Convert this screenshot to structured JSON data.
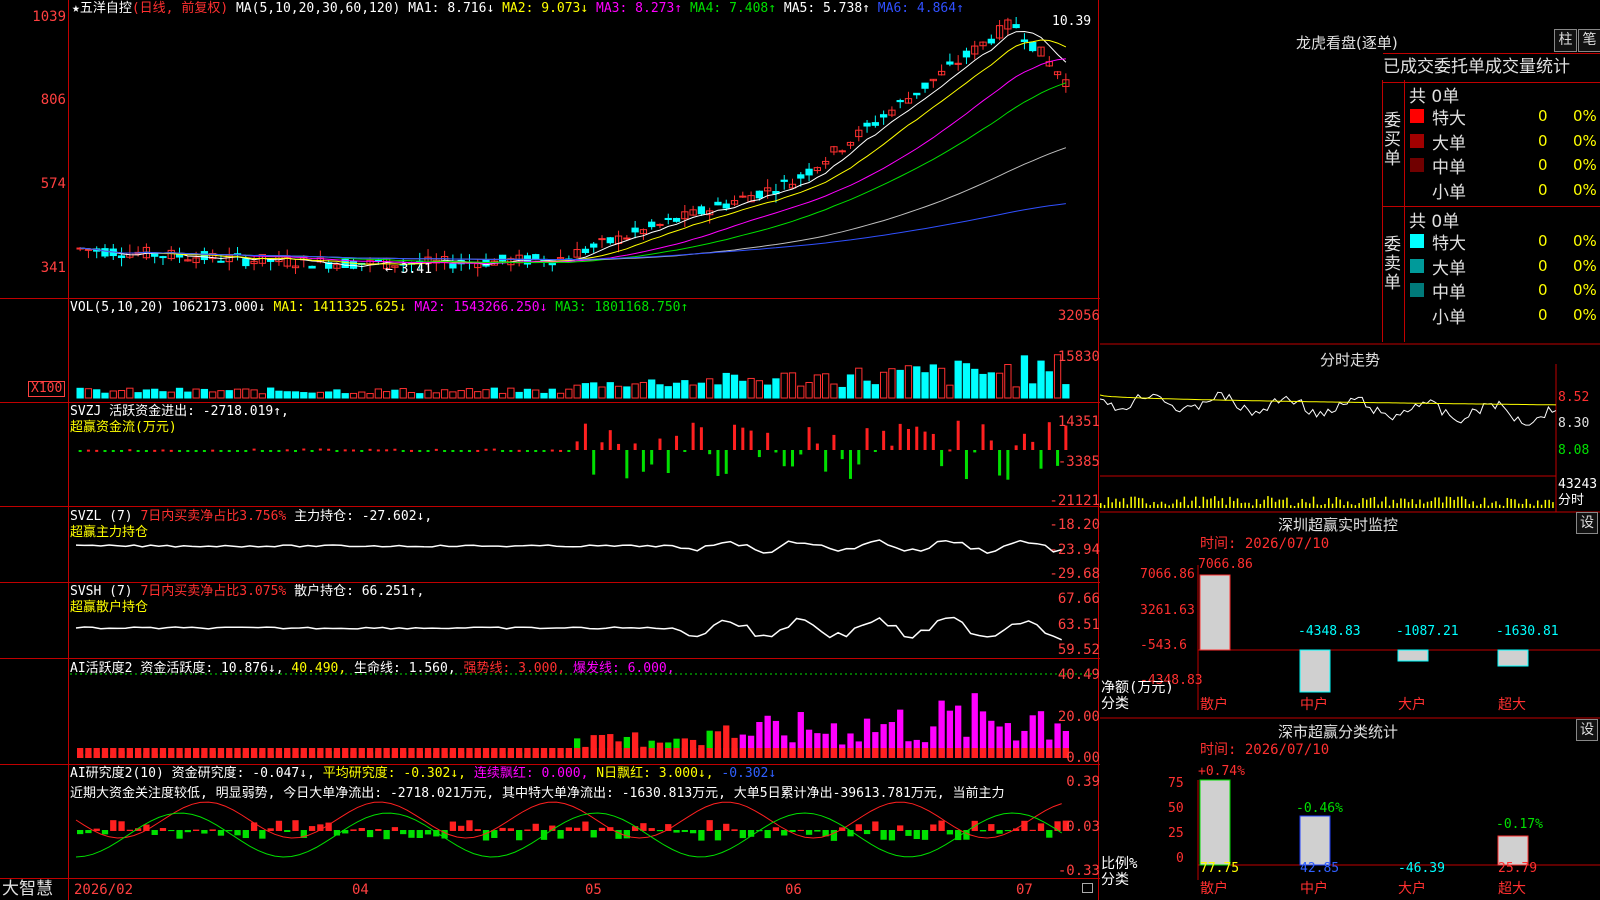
{
  "kline": {
    "title": "五洋自控",
    "period": "(日线, 前复权)",
    "ma_params": "MA(5,10,20,30,60,120)",
    "ma1": "MA1: 8.716↓",
    "ma2": "MA2: 9.073↓",
    "ma3": "MA3: 8.273↑",
    "ma4": "MA4: 7.408↑",
    "ma5": "MA5: 5.738↑",
    "ma6": "MA6: 4.864↑",
    "high_mark": "10.39",
    "low_mark": "← 3.41",
    "y_ticks": [
      "1039",
      "806",
      "574",
      "341"
    ]
  },
  "vol": {
    "label": "VOL(5,10,20)",
    "value": "1062173.000↓",
    "ma1": "MA1: 1411325.625↓",
    "ma2": "MA2: 1543266.250↓",
    "ma3": "MA3: 1801168.750↑",
    "y_ticks": [
      "32056",
      "15830"
    ],
    "unit": "X100"
  },
  "svzj": {
    "label": "SVZJ",
    "desc": "活跃资金进出: -2718.019↑,",
    "sub": "超赢资金流(万元)",
    "y_ticks": [
      "14351",
      "-3385",
      "-21121"
    ]
  },
  "svzl": {
    "label": "SVZL (7)",
    "pct": "7日内买卖净占比3.756%",
    "hold": "主力持仓: -27.602↓,",
    "sub": "超赢主力持仓",
    "y_ticks": [
      "-18.20",
      "-23.94",
      "-29.68"
    ]
  },
  "svsh": {
    "label": "SVSH (7)",
    "pct": "7日内买卖净占比3.075%",
    "hold": "散户持仓: 66.251↑,",
    "sub": "超赢散户持仓",
    "y_ticks": [
      "67.66",
      "63.51",
      "59.52"
    ]
  },
  "ai1": {
    "label": "AI活跃度2",
    "v1": "资金活跃度: 10.876↓,",
    "v2": "40.490,",
    "v3": "生命线: 1.560,",
    "v4": "强势线: 3.000,",
    "v5": "爆发线: 6.000,",
    "y_ticks": [
      "40.49",
      "20.00",
      "0.00"
    ]
  },
  "ai2": {
    "label": "AI研究度2(10)",
    "v1": "资金研究度: -0.047↓,",
    "v2": "平均研究度: -0.302↓,",
    "v3": "连续飘红: 0.000,",
    "v4": "N日飘红: 3.000↓,",
    "v5": "-0.302↓",
    "comment": "近期大资金关注度较低, 明显弱势, 今日大单净流出: -2718.021万元, 其中特大单净流出: -1630.813万元, 大单5日累计净出-39613.781万元, 当前主力",
    "y_ticks": [
      "0.39",
      "0.03",
      "-0.33"
    ]
  },
  "xaxis": {
    "brand": "大智慧",
    "labels": [
      "2026/02",
      "04",
      "05",
      "06",
      "07"
    ]
  },
  "right": {
    "lhb_title": "龙虎看盘(逐单)",
    "btn_bar": "柱",
    "btn_pen": "笔",
    "tabs": [
      "已成交",
      "委托单",
      "成交量统计"
    ],
    "buy_label": "委买单",
    "sell_label": "委卖单",
    "buy_total": "共 0单",
    "sell_total": "共 0单",
    "buy_rows": [
      {
        "name": "特大",
        "count": "0",
        "pct": "0%",
        "color": "#ff0000"
      },
      {
        "name": "大单",
        "count": "0",
        "pct": "0%",
        "color": "#a00000"
      },
      {
        "name": "中单",
        "count": "0",
        "pct": "0%",
        "color": "#700000"
      },
      {
        "name": "小单",
        "count": "0",
        "pct": "0%",
        "color": ""
      }
    ],
    "sell_rows": [
      {
        "name": "特大",
        "count": "0",
        "pct": "0%",
        "color": "#00ffff"
      },
      {
        "name": "大单",
        "count": "0",
        "pct": "0%",
        "color": "#009a9a"
      },
      {
        "name": "中单",
        "count": "0",
        "pct": "0%",
        "color": "#007a7a"
      },
      {
        "name": "小单",
        "count": "0",
        "pct": "0%",
        "color": ""
      }
    ],
    "fs_title": "分时走势",
    "fs_ticks": [
      "8.52",
      "8.30",
      "8.08",
      "43243",
      "分时"
    ],
    "sz_title": "深圳超赢实时监控",
    "sz_btn": "设",
    "sz_time": "时间: 2026/07/10",
    "sz_ticks": [
      "7066.86",
      "3261.63",
      "-543.6",
      "-4348.83"
    ],
    "sz_values": [
      "7066.86",
      "-4348.83",
      "-1087.21",
      "-1630.81"
    ],
    "sz_axis_label": "净额(万元)",
    "sz_axis_sub": "分类",
    "categories": [
      "散户",
      "中户",
      "大户",
      "超大"
    ],
    "sc_title": "深市超赢分类统计",
    "sc_btn": "设",
    "sc_time": "时间: 2026/07/10",
    "sc_ticks": [
      "75",
      "50",
      "25",
      "0"
    ],
    "sc_top": [
      "+0.74%",
      "-0.46%",
      "",
      "-0.17%"
    ],
    "sc_bottom": [
      "77.75",
      "42.85",
      "-46.39",
      "25.79"
    ],
    "sc_axis_label": "比例%",
    "sc_axis_sub": "分类"
  }
}
